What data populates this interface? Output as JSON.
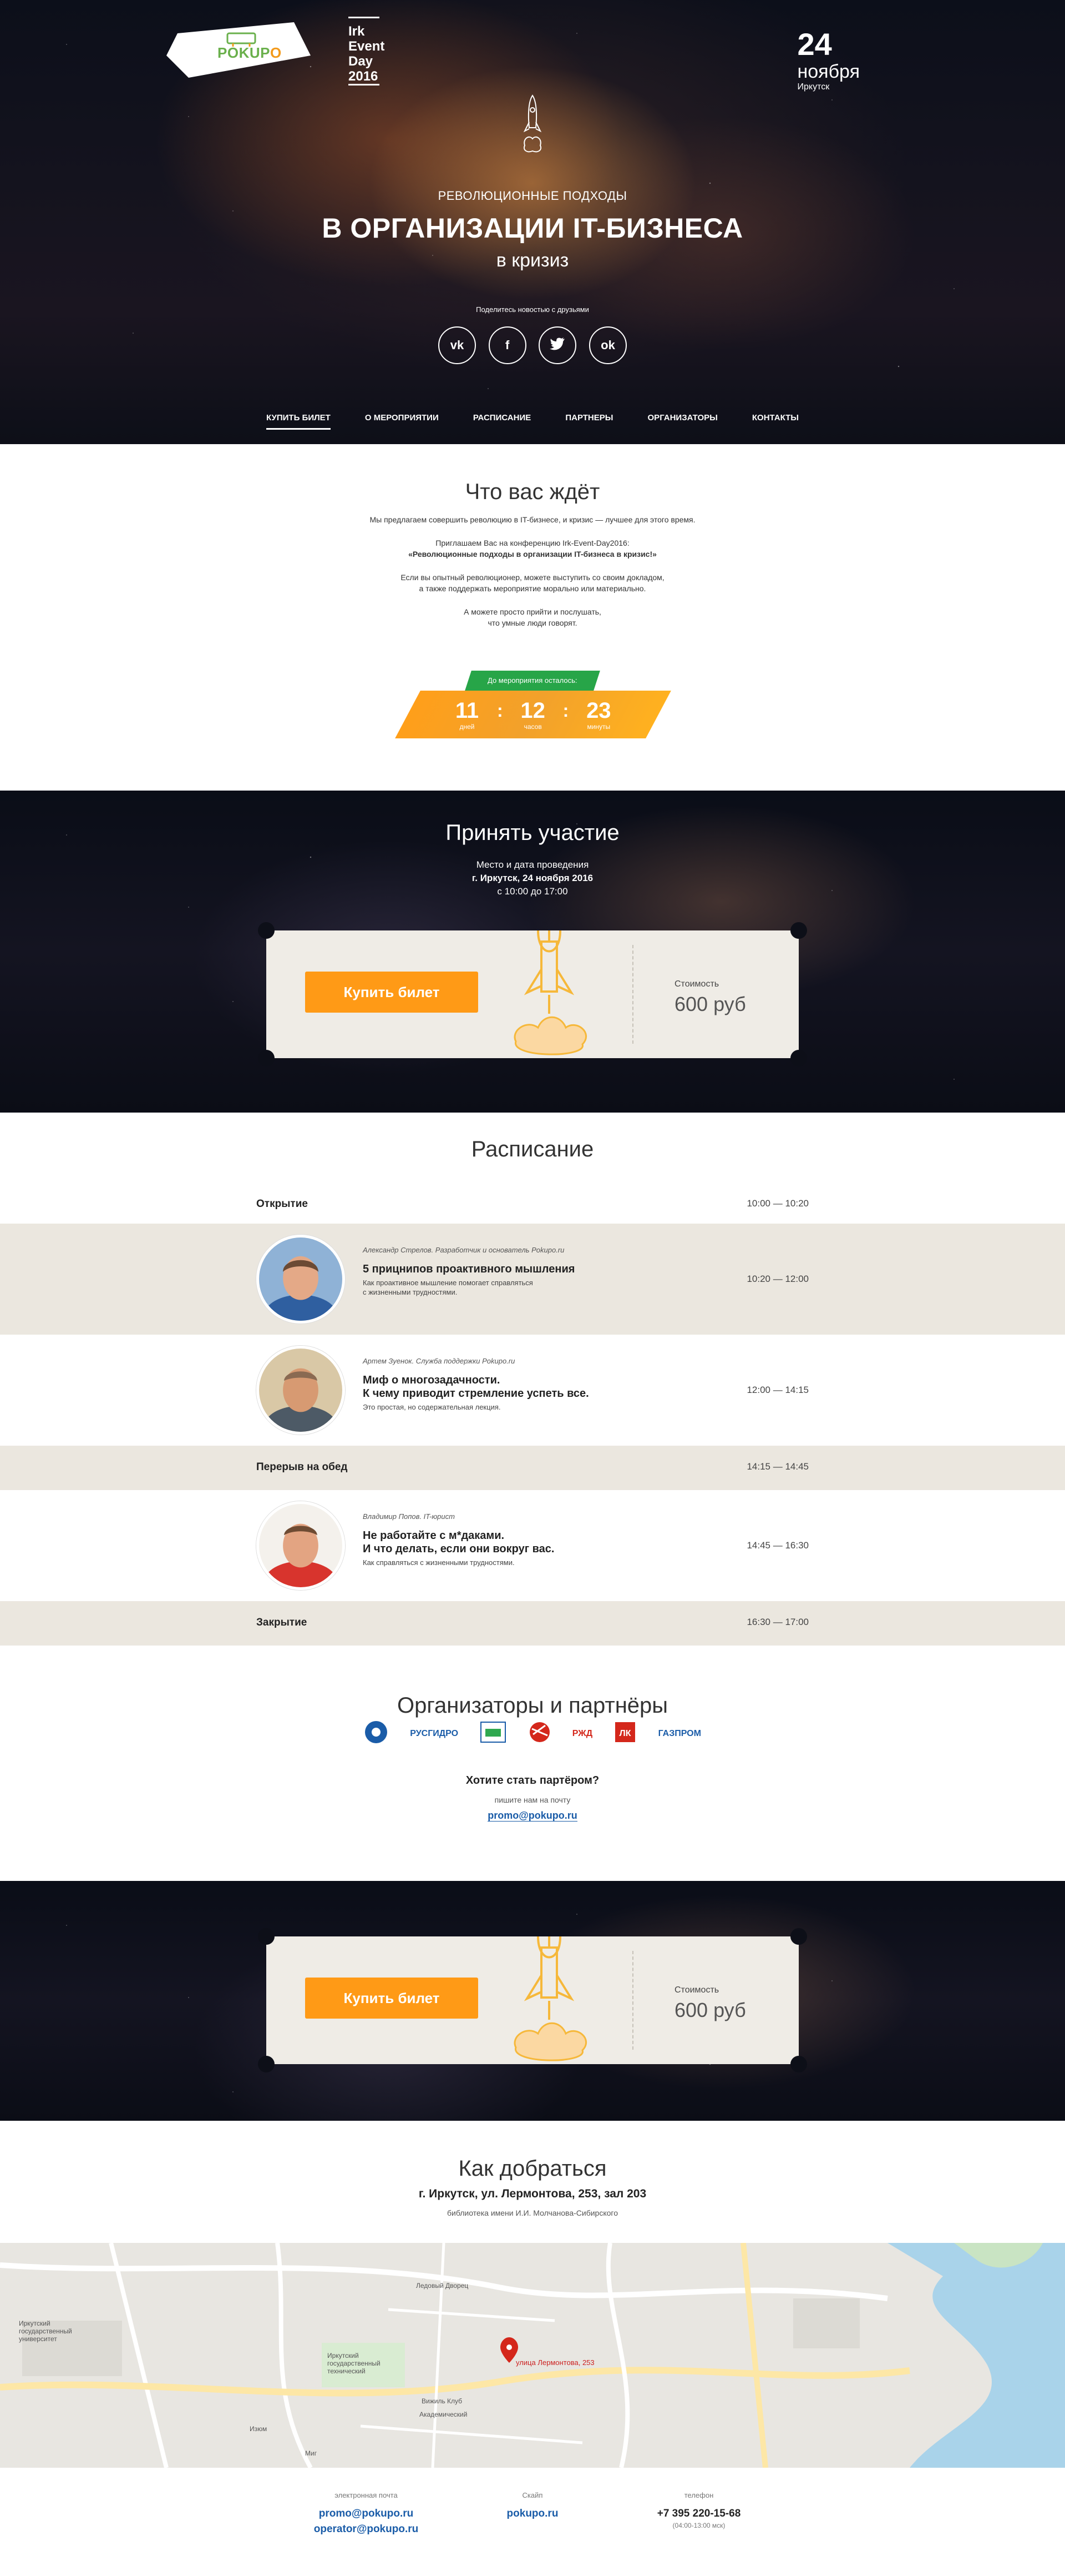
{
  "header": {
    "logo": {
      "main": "POKUP",
      "accent": "O",
      "tail": ".ru"
    },
    "event_name": [
      "Irk",
      "Event",
      "Day",
      "2016"
    ],
    "date_day": "24",
    "date_month": "ноября",
    "date_city": "Иркутск"
  },
  "hero": {
    "pre_title": "РЕВОЛЮЦИОННЫЕ ПОДХОДЫ",
    "title": "В ОРГАНИЗАЦИИ IT-БИЗНЕСА",
    "subtitle": "в кризиз",
    "share_label": "Поделитесь новостью с друзьями",
    "socials": [
      {
        "name": "vk-icon",
        "glyph": "vk"
      },
      {
        "name": "facebook-icon",
        "glyph": "f"
      },
      {
        "name": "twitter-icon",
        "glyph": "t"
      },
      {
        "name": "odnoklassniki-icon",
        "glyph": "ok"
      }
    ]
  },
  "nav": [
    "КУПИТЬ БИЛЕТ",
    "О МЕРОПРИЯТИИ",
    "РАСПИСАНИЕ",
    "ПАРТНЕРЫ",
    "ОРГАНИЗАТОРЫ",
    "КОНТАКТЫ"
  ],
  "about": {
    "title": "Что вас ждёт",
    "p1": "Мы предлагаем совершить революцию в IT-бизнесе, и кризис — лучшее для этого время.",
    "p2_line1": "Приглашаем Вас на конференцию Irk-Event-Day2016:",
    "p2_line2": "«Революционные подходы в организации IT-бизнеса в кризис!»",
    "p3_line1": "Если вы опытный революционер, можете выступить со своим докладом,",
    "p3_line2": "а также поддержать мероприятие морально или материально.",
    "p4_line1": "А можете просто прийти и послушать,",
    "p4_line2": "что умные люди говорят.",
    "countdown_label": "До мероприятия осталось:",
    "countdown": [
      {
        "value": "11",
        "unit": "дней"
      },
      {
        "value": "12",
        "unit": "часов"
      },
      {
        "value": "23",
        "unit": "минуты"
      }
    ]
  },
  "participate": {
    "title": "Принять участие",
    "venue_label": "Место и дата проведения",
    "venue": "г. Иркутск, 24 ноября 2016",
    "hours": "с 10:00 до 17:00"
  },
  "ticket": {
    "button": "Купить билет",
    "price_label": "Стоимость",
    "price": "600 руб"
  },
  "schedule": {
    "title": "Расписание",
    "opening": {
      "name": "Открытие",
      "time": "10:00 — 10:20"
    },
    "talks": [
      {
        "speaker": "Александр Стрелов. Разработчик и основатель Pokupo.ru",
        "title1": "5 прицнипов проактивного мышления",
        "title2": "",
        "desc1": "Как проактивное мышление помогает справляться",
        "desc2": "с жизненными трудностями.",
        "time": "10:20 — 12:00"
      },
      {
        "speaker": "Артем Зуенок. Служба поддержки Pokupo.ru",
        "title1": "Миф о многозадачности.",
        "title2": "К чему приводит стремление успеть все.",
        "desc1": "Это простая, но содержательная лекция.",
        "desc2": "",
        "time": "12:00 — 14:15"
      },
      {
        "speaker": "Владимир Попов. IT-юрист",
        "title1": "Не работайте с м*даками.",
        "title2": "И что делать, если они вокруг вас.",
        "desc1": "Как справляться с жизненными трудностями.",
        "desc2": "",
        "time": "14:45 — 16:30"
      }
    ],
    "lunch": {
      "name": "Перерыв на обед",
      "time": "14:15 — 14:45"
    },
    "closing": {
      "name": "Закрытие",
      "time": "16:30 — 17:00"
    }
  },
  "partners": {
    "title": "Организаторы и партнёры",
    "logos": [
      "ROSATOM",
      "РУСГИДРО",
      "ENERGO",
      "",
      "РЖД",
      "ЛУКОЙЛ",
      "ГАЗПРОМ"
    ],
    "question": "Хотите стать партёром?",
    "hint": "пишите нам на почту",
    "email": "promo@pokupo.ru"
  },
  "directions": {
    "title": "Как добраться",
    "address": "г. Иркутск, ул. Лермонтова, 253, зал 203",
    "library": "библиотека имени И.И. Молчанова-Сибирского",
    "map_labels": {
      "ice": "Ледовый Дворец",
      "uni": "Иркутский государственный университет",
      "univ2": "Иркутский государственный технический",
      "club": "Вижиль Клуб",
      "acad": "Академический",
      "pin": "улица Лермонтова, 253",
      "izum": "Изюм",
      "mig": "Миг"
    }
  },
  "footer": {
    "email_label": "электронная почта",
    "email1": "promo@pokupo.ru",
    "email2": "operator@pokupo.ru",
    "skype_label": "Скайп",
    "skype": "pokupo.ru",
    "phone_label": "телефон",
    "phone": "+7 395 220-15-68",
    "phone_hours": "(04:00-13:00 мск)"
  }
}
